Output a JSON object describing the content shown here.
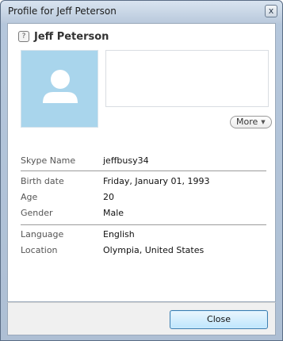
{
  "window": {
    "title": "Profile for Jeff Peterson",
    "close_glyph": "x"
  },
  "profile": {
    "status_icon": "question-status-icon",
    "status_glyph": "?",
    "name": "Jeff Peterson"
  },
  "more_button": {
    "label": "More",
    "caret": "▼"
  },
  "fields": {
    "skype_name": {
      "label": "Skype Name",
      "value": "jeffbusy34"
    },
    "birth_date": {
      "label": "Birth date",
      "value": "Friday, January 01, 1993"
    },
    "age": {
      "label": "Age",
      "value": "20"
    },
    "gender": {
      "label": "Gender",
      "value": "Male"
    },
    "language": {
      "label": "Language",
      "value": "English"
    },
    "location": {
      "label": "Location",
      "value": "Olympia, United States"
    }
  },
  "footer": {
    "close_label": "Close"
  },
  "colors": {
    "avatar_bg": "#a9d5ec",
    "button_border": "#3c7fb1"
  }
}
